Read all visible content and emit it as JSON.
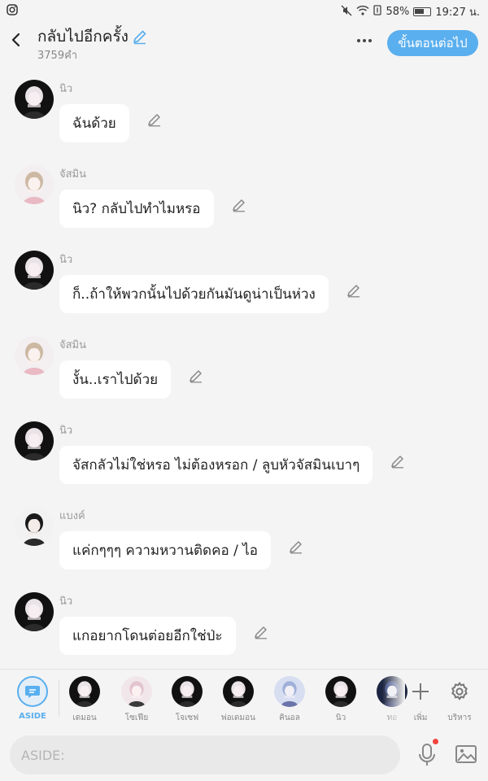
{
  "status_bar": {
    "battery_percent": "58%",
    "time": "19:27 น."
  },
  "header": {
    "title": "กลับไปอีกครั้ง",
    "word_count": "3759คำ",
    "next_button": "ขั้นตอนต่อไป"
  },
  "messages": [
    {
      "sender": "นิว",
      "text": "ฉันด้วย",
      "avatar_style": "dark"
    },
    {
      "sender": "จัสมิน",
      "text": "นิว? กลับไปทำไมหรอ",
      "avatar_style": "light"
    },
    {
      "sender": "นิว",
      "text": "ก็..ถ้าให้พวกนั้นไปด้วยกันมันดูน่าเป็นห่วง",
      "avatar_style": "dark"
    },
    {
      "sender": "จัสมิน",
      "text": "งั้น..เราไปด้วย",
      "avatar_style": "light"
    },
    {
      "sender": "นิว",
      "text": "จัสกลัวไม่ใช่หรอ ไม่ต้องหรอก / ลูบหัวจัสมินเบาๆ",
      "avatar_style": "dark"
    },
    {
      "sender": "แบงค์",
      "text": "แค่กๆๆๆ ความหวานติดคอ / ไอ",
      "avatar_style": "boy"
    },
    {
      "sender": "นิว",
      "text": "แกอยากโดนต่อยอีกใช่ป่ะ",
      "avatar_style": "dark"
    }
  ],
  "characters": [
    {
      "label": "ASIDE",
      "avatar_style": "aside"
    },
    {
      "label": "เดมอน",
      "avatar_style": "dark"
    },
    {
      "label": "โซเฟีย",
      "avatar_style": "pink"
    },
    {
      "label": "โจเซฟ",
      "avatar_style": "dark"
    },
    {
      "label": "พ่อเดมอน",
      "avatar_style": "dark"
    },
    {
      "label": "คินอล",
      "avatar_style": "blue"
    },
    {
      "label": "นิว",
      "avatar_style": "dark"
    },
    {
      "label": "ทอ",
      "avatar_style": "navy"
    }
  ],
  "tools": {
    "add_label": "เพิ่ม",
    "manage_label": "บริหาร"
  },
  "input": {
    "placeholder": "ASIDE:"
  },
  "colors": {
    "accent": "#5aafee",
    "background": "#f4f4f4",
    "bubble": "#ffffff",
    "recording_dot": "#f2443a"
  }
}
